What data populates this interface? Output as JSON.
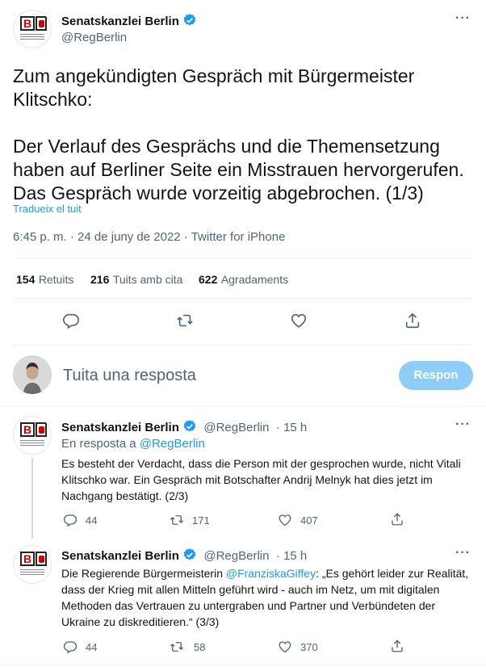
{
  "main_tweet": {
    "name": "Senatskanzlei Berlin",
    "handle": "@RegBerlin",
    "text_p1": "Zum angekündigten Gespräch mit Bürgermeister Klitschko:",
    "text_p2": "Der Verlauf des Gesprächs und die Themensetzung haben auf Berliner Seite ein Misstrauen hervorgerufen. Das Gespräch wurde vorzeitig abgebrochen. (1/3)",
    "translate": "Tradueix el tuit",
    "timestamp": "6:45 p. m. · 24 de juny de 2022 · Twitter for iPhone",
    "stats": {
      "retweets_count": "154",
      "retweets_label": "Retuits",
      "quotes_count": "216",
      "quotes_label": "Tuits amb cita",
      "likes_count": "622",
      "likes_label": "Agradaments"
    }
  },
  "reply_box": {
    "placeholder": "Tuita una resposta",
    "button": "Respon"
  },
  "thread": [
    {
      "name": "Senatskanzlei Berlin",
      "handle": "@RegBerlin",
      "time": "· 15 h",
      "reply_to_prefix": "En resposta a ",
      "reply_to_handle": "@RegBerlin",
      "text": "Es besteht der Verdacht, dass die Person mit der gesprochen wurde, nicht Vitali Klitschko war. Ein Gespräch mit Botschafter Andrij Melnyk hat dies jetzt im Nachgang bestätigt. (2/3)",
      "replies": "44",
      "retweets": "171",
      "likes": "407"
    },
    {
      "name": "Senatskanzlei Berlin",
      "handle": "@RegBerlin",
      "time": "· 15 h",
      "text_prefix": "Die Regierende Bürgermeisterin ",
      "mention": "@FranziskaGiffey",
      "text_suffix": ": „Es gehört leider zur Realität, dass der Krieg mit allen Mitteln geführt wird - auch im Netz, um mit digitalen Methoden das Vertrauen zu untergraben und Partner und Verbündeten der Ukraine zu diskreditieren.“ (3/3)",
      "replies": "44",
      "retweets": "58",
      "likes": "370"
    }
  ],
  "colors": {
    "accent": "#1d9bf0",
    "button_disabled": "#8ecdf8",
    "muted": "#536471",
    "text": "#0f1419"
  },
  "icons": [
    "verified-badge-icon",
    "more-icon",
    "reply-icon",
    "retweet-icon",
    "like-icon",
    "share-icon"
  ]
}
